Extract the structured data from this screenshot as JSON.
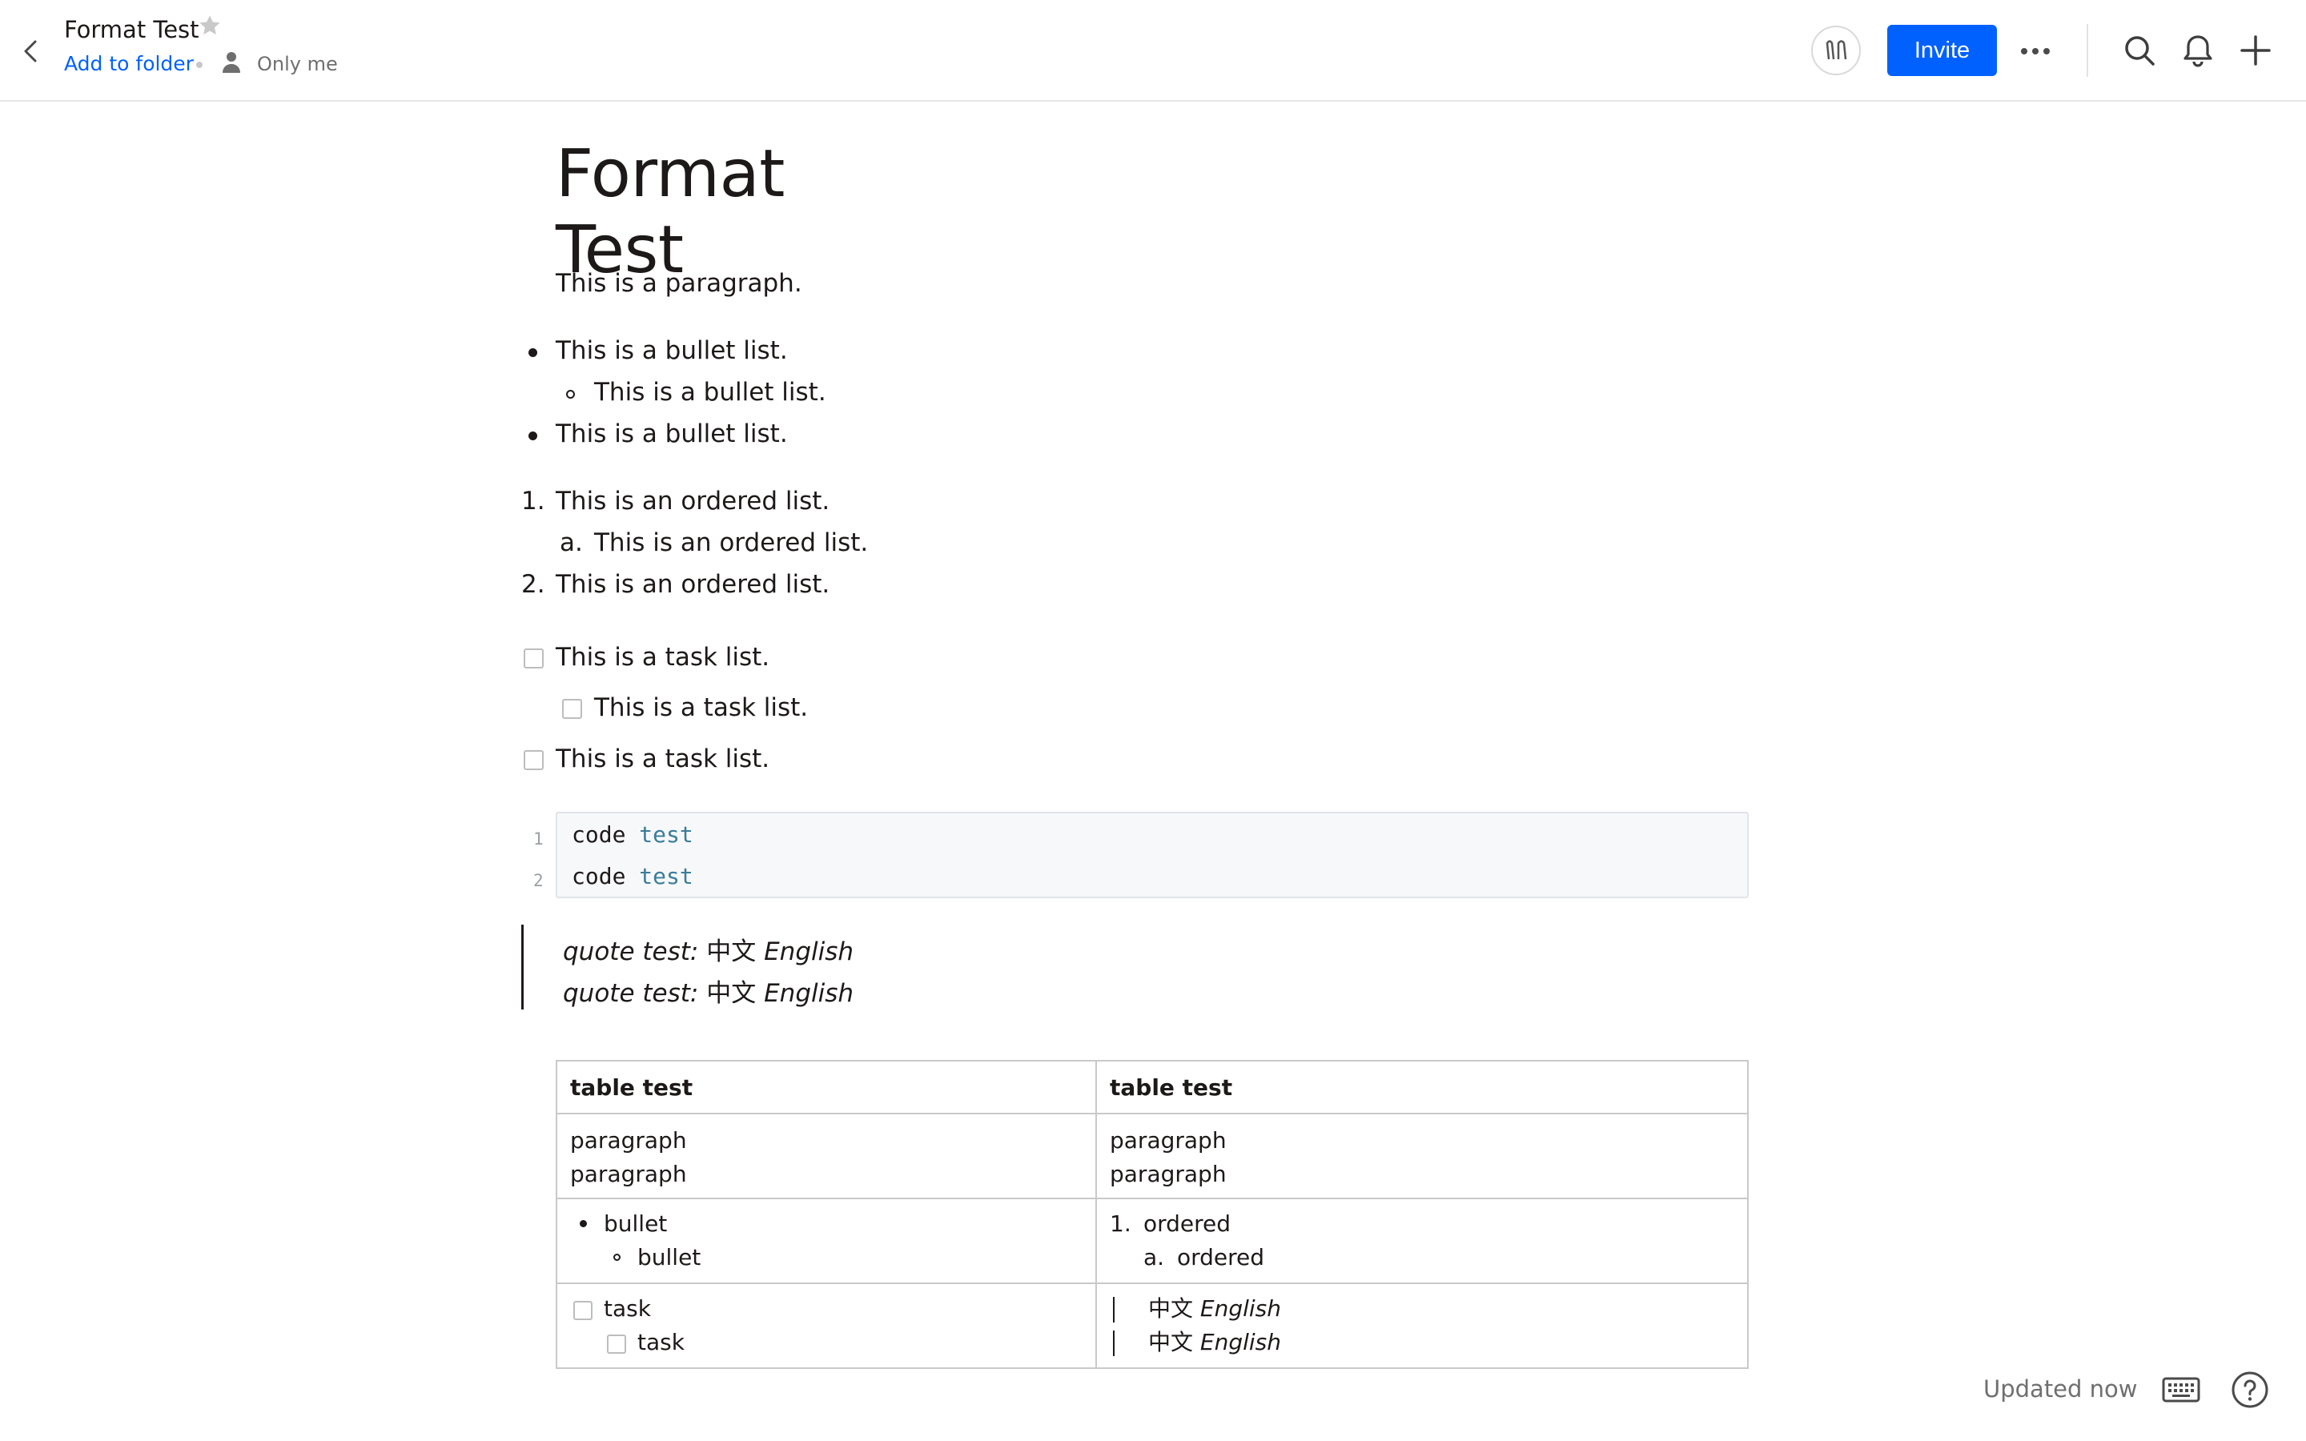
{
  "header": {
    "doc_title": "Format Test",
    "add_to_folder": "Add to folder",
    "sharing": "Only me",
    "invite_label": "Invite",
    "icons": [
      "back-icon",
      "star-icon",
      "person-icon",
      "avatar",
      "more-icon",
      "search-icon",
      "bell-icon",
      "plus-icon"
    ]
  },
  "doc": {
    "title": "Format Test",
    "paragraph": "This is a paragraph.",
    "bullets": [
      "This is a bullet list.",
      "This is a bullet list.",
      "This is a bullet list."
    ],
    "ordered": [
      {
        "marker": "1.",
        "text": "This is an ordered list."
      },
      {
        "marker": "a.",
        "text": "This is an ordered list."
      },
      {
        "marker": "2.",
        "text": "This is an ordered list."
      }
    ],
    "tasks": [
      "This is a task list.",
      "This is a task list.",
      "This is a task list."
    ],
    "code": {
      "line_numbers": [
        "1",
        "2"
      ],
      "lines": [
        {
          "plain": "code ",
          "keyword": "test"
        },
        {
          "plain": "code ",
          "keyword": "test"
        }
      ]
    },
    "quotes": [
      {
        "label": "quote test:",
        "cjk": " 中文 ",
        "english": "English"
      },
      {
        "label": "quote test:",
        "cjk": " 中文 ",
        "english": "English"
      }
    ],
    "table": {
      "headers": [
        "table test",
        "table test"
      ],
      "row1": {
        "left": [
          "paragraph",
          "paragraph"
        ],
        "right": [
          "paragraph",
          "paragraph"
        ]
      },
      "row2": {
        "left": [
          "bullet",
          "bullet"
        ],
        "right": [
          {
            "marker": "1.",
            "text": "ordered"
          },
          {
            "marker": "a.",
            "text": "ordered"
          }
        ]
      },
      "row3": {
        "left": [
          "task",
          "task"
        ],
        "right": [
          {
            "cjk": "中文 ",
            "english": "English"
          },
          {
            "cjk": "中文 ",
            "english": "English"
          }
        ]
      }
    }
  },
  "footer": {
    "status": "Updated now",
    "icons": [
      "keyboard-icon",
      "help-icon"
    ]
  },
  "colors": {
    "accent": "#0061fe",
    "text": "#1e1919",
    "muted": "#6f6f6f",
    "code_keyword": "#3a7d9a"
  }
}
